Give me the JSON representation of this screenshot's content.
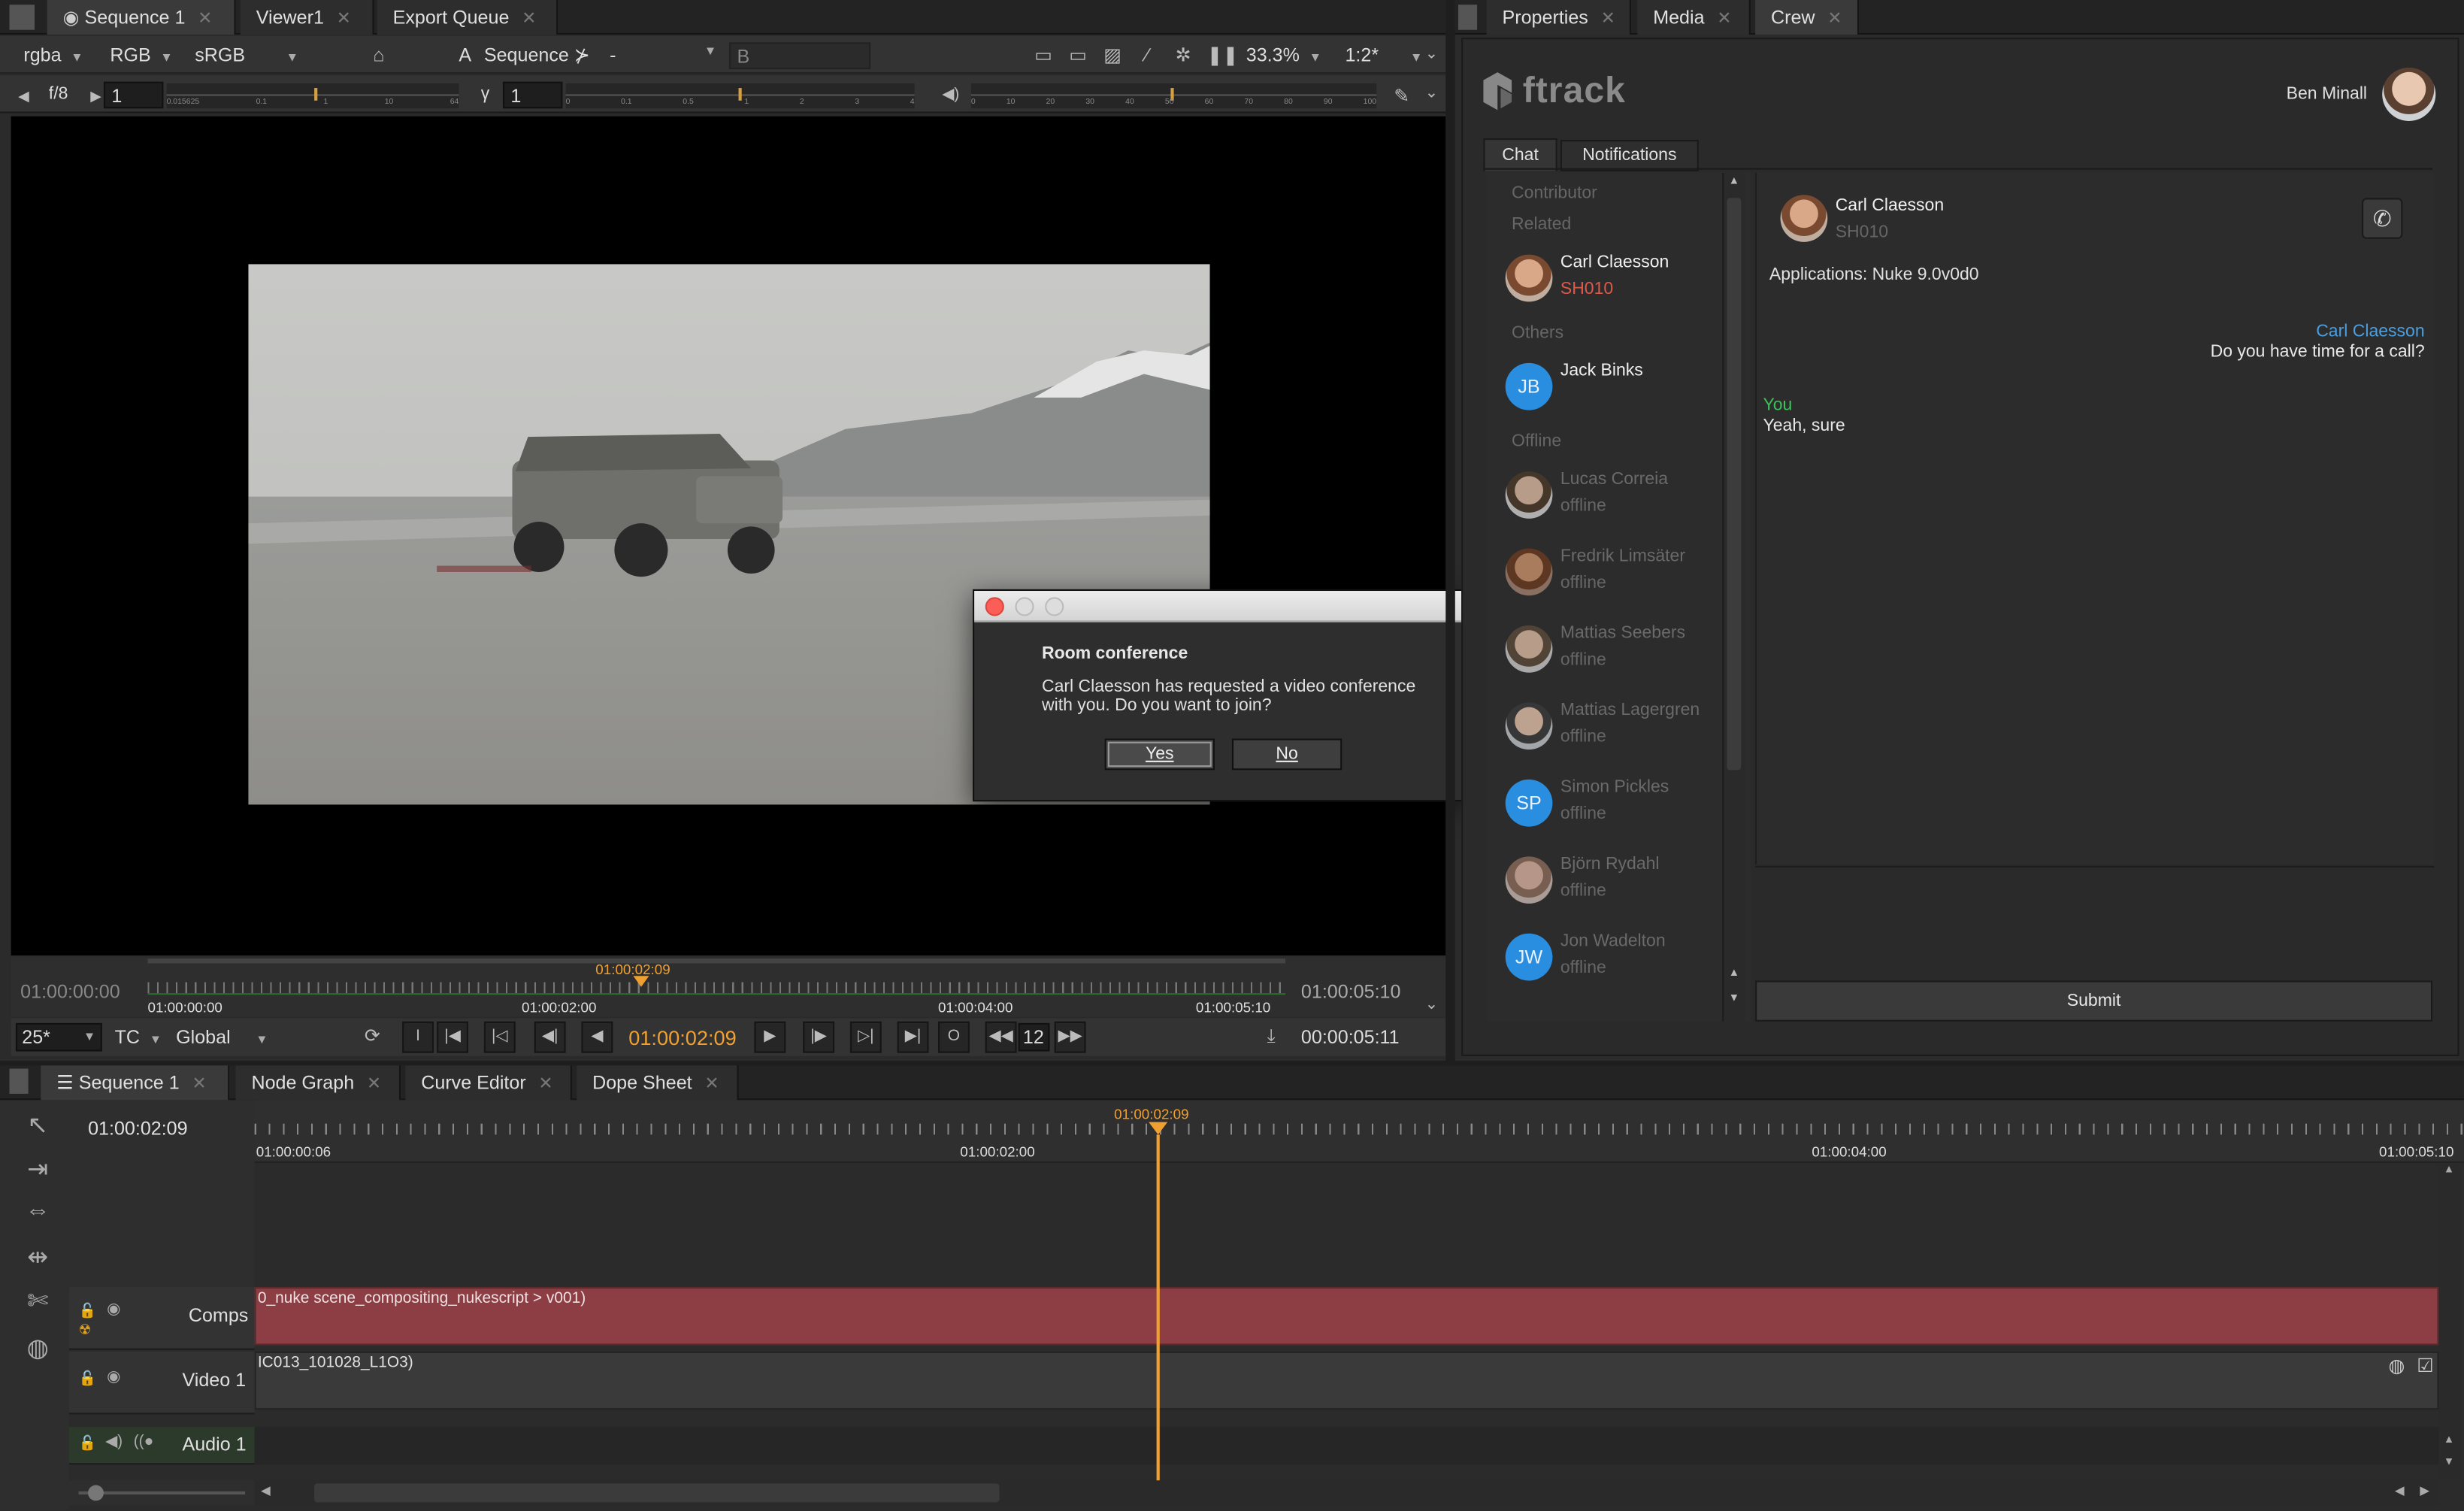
{
  "viewer_tabs": [
    {
      "label": "Sequence 1",
      "icon": "eye-icon"
    },
    {
      "label": "Viewer1"
    },
    {
      "label": "Export Queue"
    }
  ],
  "right_tabs": [
    {
      "label": "Properties"
    },
    {
      "label": "Media"
    },
    {
      "label": "Crew"
    }
  ],
  "viewer_toolbar": {
    "channels": "rgba",
    "colorspace1": "RGB",
    "colorspace2": "sRGB",
    "a_label": "A",
    "a_input": "Sequence",
    "dash": "-",
    "b_label": "B",
    "zoom": "33.3%",
    "ratio": "1:2*"
  },
  "viewer_toolbar2": {
    "fstop_label": "f/8",
    "gain_value": "1",
    "gain_ticks": [
      "0.015625",
      "0.1",
      "1",
      "10",
      "64"
    ],
    "gamma_label": "γ",
    "gamma_value": "1",
    "gamma_ticks": [
      "0",
      "0.1",
      "0.5",
      "1",
      "2",
      "3",
      "4"
    ],
    "vol_ticks": [
      "0",
      "10",
      "20",
      "30",
      "40",
      "50",
      "60",
      "70",
      "80",
      "90",
      "100"
    ]
  },
  "viewer_timeline": {
    "start": "01:00:00:00",
    "end": "01:00:05:10",
    "current": "01:00:02:09",
    "ticks": [
      "01:00:00:00",
      "01:00:02:00",
      "01:00:04:00",
      "01:00:05:10"
    ]
  },
  "playback": {
    "fps": "25*",
    "tc": "TC",
    "scope": "Global",
    "in_label": "I",
    "out_label": "O",
    "timecode": "01:00:02:09",
    "step": "12",
    "duration": "00:00:05:11"
  },
  "dialog": {
    "title": "Room conference",
    "message": "Carl Claesson has requested a video conference with you. Do you want to join?",
    "yes": "Yes",
    "no": "No"
  },
  "ftrack": {
    "logo": "ftrack",
    "user": "Ben Minall",
    "tabs": [
      "Chat",
      "Notifications"
    ],
    "sections": {
      "contributor": "Contributor",
      "related": "Related",
      "others": "Others",
      "offline": "Offline"
    },
    "related": [
      {
        "name": "Carl Claesson",
        "status": "SH010"
      }
    ],
    "others": [
      {
        "name": "Jack Binks",
        "initials": "JB"
      }
    ],
    "offline": [
      {
        "name": "Lucas Correia",
        "status": "offline"
      },
      {
        "name": "Fredrik Limsäter",
        "status": "offline"
      },
      {
        "name": "Mattias Seebers",
        "status": "offline"
      },
      {
        "name": "Mattias Lagergren",
        "status": "offline"
      },
      {
        "name": "Simon Pickles",
        "status": "offline",
        "initials": "SP"
      },
      {
        "name": "Björn Rydahl",
        "status": "offline"
      },
      {
        "name": "Jon Wadelton",
        "status": "offline",
        "initials": "JW"
      }
    ],
    "chat": {
      "header_name": "Carl Claesson",
      "header_sub": "SH010",
      "applications": "Applications: Nuke 9.0v0d0",
      "messages": [
        {
          "author": "Carl Claesson",
          "text": "Do you have time for a call?"
        },
        {
          "author": "You",
          "text": "Yeah, sure"
        }
      ],
      "submit": "Submit"
    }
  },
  "bottom_tabs": [
    {
      "label": "Sequence 1"
    },
    {
      "label": "Node Graph"
    },
    {
      "label": "Curve Editor"
    },
    {
      "label": "Dope Sheet"
    }
  ],
  "timeline": {
    "current": "01:00:02:09",
    "marker": "01:00:02:09",
    "ticks": [
      "01:00:00:06",
      "01:00:02:00",
      "01:00:04:00",
      "01:00:05:10"
    ],
    "tracks": [
      {
        "name": "Comps",
        "clip": "0_nuke scene_compositing_nukescript > v001)"
      },
      {
        "name": "Video 1",
        "clip": "IC013_101028_L1O3)"
      },
      {
        "name": "Audio 1"
      }
    ]
  },
  "colors": {
    "accent_orange": "#f0a030",
    "comp_clip": "#8c3e44",
    "link_blue": "#4a9fe0",
    "you_green": "#3cc25a",
    "shot_red": "#e0584a",
    "avatar_blue": "#2a8ee0"
  }
}
